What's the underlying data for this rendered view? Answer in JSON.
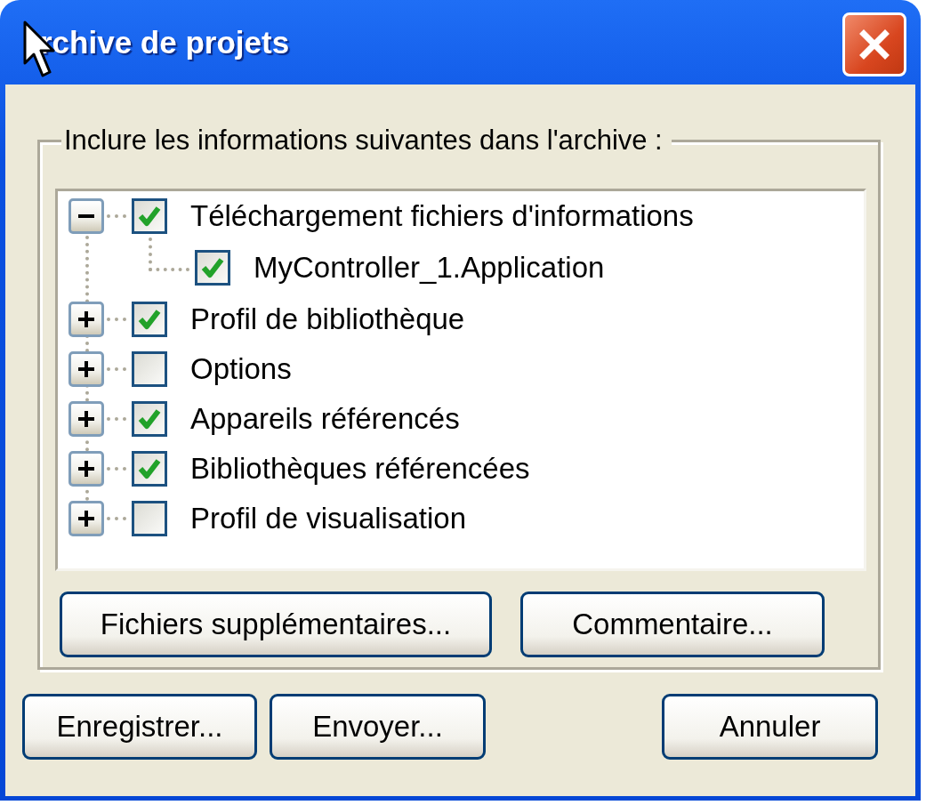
{
  "window": {
    "title": "rchive de projets"
  },
  "group": {
    "label": "Inclure les informations suivantes dans l'archive :",
    "tree": [
      {
        "label": "Téléchargement fichiers d'informations",
        "checked": true,
        "expanded": true,
        "children": [
          {
            "label": "MyController_1.Application",
            "checked": true
          }
        ]
      },
      {
        "label": "Profil de bibliothèque",
        "checked": true,
        "expanded": false
      },
      {
        "label": "Options",
        "checked": false,
        "expanded": false
      },
      {
        "label": "Appareils référencés",
        "checked": true,
        "expanded": false
      },
      {
        "label": "Bibliothèques référencées",
        "checked": true,
        "expanded": false
      },
      {
        "label": "Profil de visualisation",
        "checked": false,
        "expanded": false
      }
    ],
    "buttons": [
      "Fichiers supplémentaires...",
      "Commentaire..."
    ]
  },
  "buttons": [
    {
      "label": "Enregistrer...",
      "kind": "left"
    },
    {
      "label": "Envoyer...",
      "kind": "left"
    },
    {
      "label": "Annuler",
      "kind": "right"
    }
  ]
}
